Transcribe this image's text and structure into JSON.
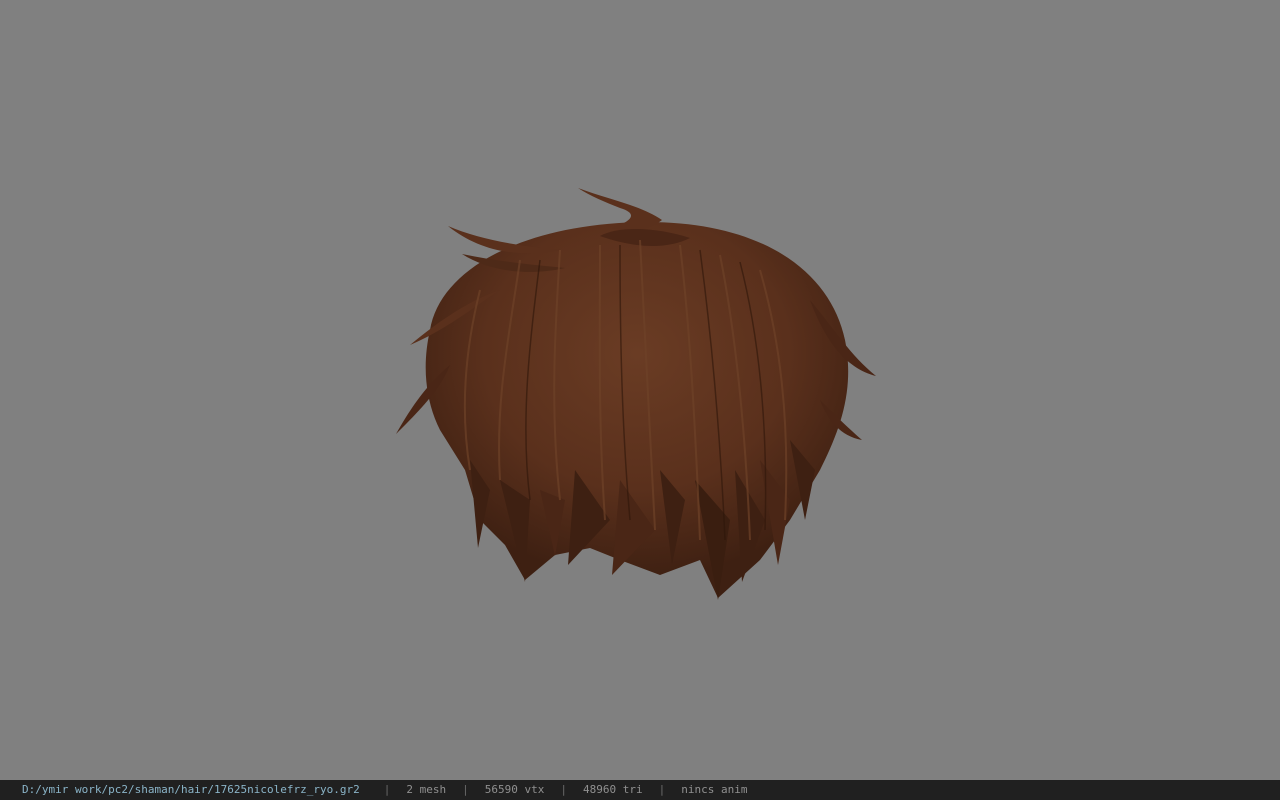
{
  "viewport": {
    "background_color": "#808080",
    "model": {
      "subject": "hair-mesh",
      "primary_color": "#5e3420",
      "shadow_color": "#3a1e10",
      "highlight_color": "#7a4a2e"
    }
  },
  "status_bar": {
    "file_path": "D:/ymir work/pc2/shaman/hair/17625nicolefrz_ryo.gr2",
    "separator": "|",
    "mesh_count": "2 mesh",
    "vertex_count": "56590 vtx",
    "triangle_count": "48960 tri",
    "anim_status": "nincs anim",
    "background_color": "#202020",
    "path_color": "#8ab4c8"
  }
}
